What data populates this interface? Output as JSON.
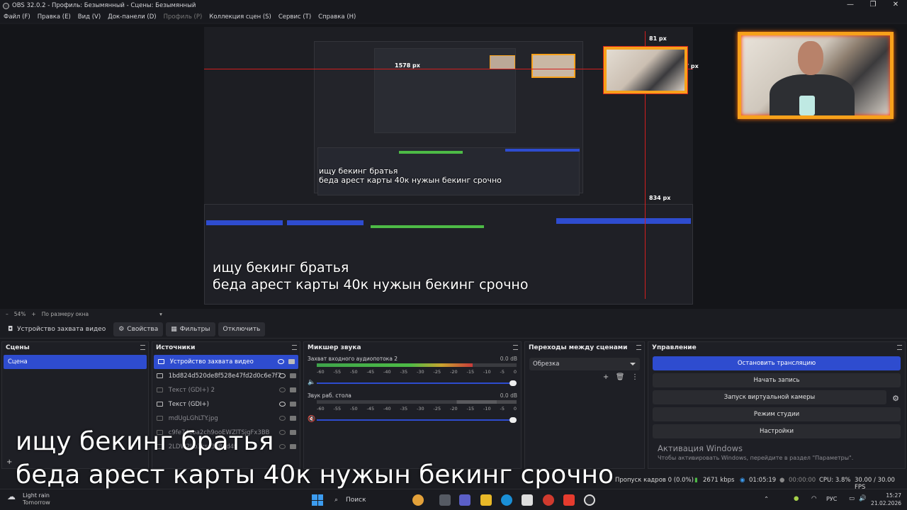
{
  "window": {
    "title": "OBS 32.0.2 - Профиль: Безымянный - Сцены: Безымянный",
    "controls": [
      "—",
      "❐",
      "✕"
    ]
  },
  "menu": {
    "items": [
      {
        "label": "Файл (F)"
      },
      {
        "label": "Правка (E)"
      },
      {
        "label": "Вид (V)"
      },
      {
        "label": "Док-панели (D)"
      },
      {
        "label": "Профиль (P)",
        "disabled": true
      },
      {
        "label": "Коллекция сцен (S)"
      },
      {
        "label": "Сервис (T)"
      },
      {
        "label": "Справка (H)"
      }
    ]
  },
  "preview": {
    "measure_labels": [
      "1578 px",
      "81 px",
      "47 px",
      "834 px"
    ],
    "caption_lines": [
      "ищу бекинг братья",
      "беда арест карты 40к нужын бекинг срочно"
    ],
    "zoom": "54%",
    "fit_mode": "По размеру окна"
  },
  "source_toolbar": {
    "selected_source": "Устройство захвата видео",
    "properties_label": "Свойства",
    "filters_label": "Фильтры",
    "deactivate_label": "Отключить"
  },
  "scenes": {
    "title": "Сцены",
    "items": [
      "Сцена"
    ]
  },
  "sources": {
    "title": "Источники",
    "items": [
      {
        "label": "Устройство захвата видео",
        "visible": true
      },
      {
        "label": "1bd824d520de8f528e47fd2d0c6e7f7",
        "visible": true
      },
      {
        "label": "Текст (GDI+) 2",
        "visible": false
      },
      {
        "label": "Текст (GDI+)",
        "visible": true
      },
      {
        "label": "mdUgLGhLTY.jpg",
        "visible": false
      },
      {
        "label": "c9fe74coa2ch9ooEWZlTSjgFx3BB",
        "visible": false
      },
      {
        "label": "2LDW2Lb3ksc3d8bd4f",
        "visible": false
      }
    ]
  },
  "mixer": {
    "title": "Микшер звука",
    "scale": [
      "-60",
      "-55",
      "-50",
      "-45",
      "-40",
      "-35",
      "-30",
      "-25",
      "-20",
      "-15",
      "-10",
      "-5",
      "0"
    ],
    "tracks": [
      {
        "name": "Захват входного аудиопотока 2",
        "db": "0.0 dB",
        "level": 0.78
      },
      {
        "name": "Звук раб. стола",
        "db": "0.0 dB",
        "level": 0.0
      }
    ]
  },
  "transitions": {
    "title": "Переходы между сценами",
    "selected": "Обрезка"
  },
  "controls": {
    "title": "Управление",
    "stop_stream": "Остановить трансляцию",
    "start_record": "Начать запись",
    "virtual_cam": "Запуск виртуальной камеры",
    "studio_mode": "Режим студии",
    "settings": "Настройки"
  },
  "activation": {
    "title": "Активация Windows",
    "subtitle": "Чтобы активировать Windows, перейдите в раздел \"Параметры\"."
  },
  "statusbar": {
    "dropped_frames": "Пропуск кадров 0 (0.0%)",
    "bitrate": "2671 kbps",
    "stream_time": "01:05:19",
    "record_time": "00:00:00",
    "cpu": "CPU: 3.8%",
    "fps": "30.00 / 30.00 FPS"
  },
  "overlay_caption": [
    "ищу бекинг братья",
    "беда арест карты 40к нужын бекинг срочно"
  ],
  "taskbar": {
    "weather_title": "Light rain",
    "weather_sub": "Tomorrow",
    "search_label": "Поиск",
    "language": "РУС",
    "time": "15:27",
    "date": "21.02.2026"
  },
  "colors": {
    "accent": "#2e4ccf",
    "measure_red": "#d21e1e",
    "fire_border": "#f7a11b"
  }
}
